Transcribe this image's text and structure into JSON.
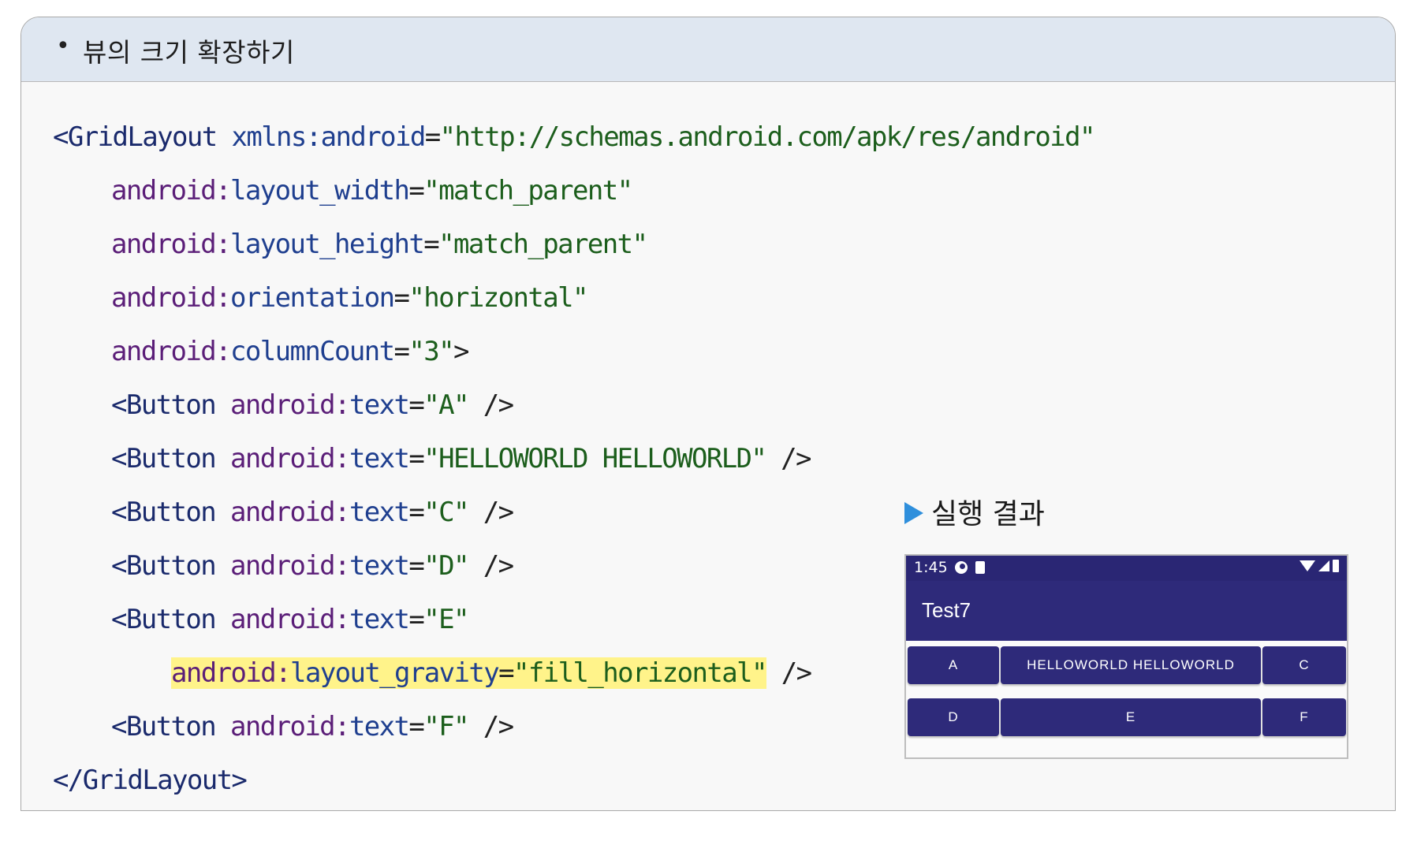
{
  "header": {
    "bullet": "•",
    "title": "뷰의 크기 확장하기"
  },
  "code": {
    "l1_open": "<GridLayout",
    "l1_attr": "xmlns:android",
    "l1_eq": "=",
    "l1_val": "\"http://schemas.android.com/apk/res/android\"",
    "l2_ns": "android:",
    "l2_attr": "layout_width",
    "l2_eq": "=",
    "l2_val": "\"match_parent\"",
    "l3_ns": "android:",
    "l3_attr": "layout_height",
    "l3_eq": "=",
    "l3_val": "\"match_parent\"",
    "l4_ns": "android:",
    "l4_attr": "orientation",
    "l4_eq": "=",
    "l4_val": "\"horizontal\"",
    "l5_ns": "android:",
    "l5_attr": "columnCount",
    "l5_eq": "=",
    "l5_val": "\"3\"",
    "l5_close": ">",
    "btn_tag": "<Button",
    "btn_ns": "android:",
    "btn_attr": "text",
    "btn_eq": "=",
    "btn_end": " />",
    "l6_val": "\"A\"",
    "l7_val": "\"HELLOWORLD HELLOWORLD\"",
    "l8_val": "\"C\"",
    "l9_val": "\"D\"",
    "l10_val": "\"E\"",
    "l11_ns": "android:",
    "l11_attr": "layout_gravity",
    "l11_eq": "=",
    "l11_val": "\"fill_horizontal\"",
    "l11_end": " />",
    "l12_val": "\"F\"",
    "l13_close": "</GridLayout>"
  },
  "result": {
    "label": "실행 결과",
    "status_time": "1:45",
    "app_title": "Test7",
    "row1": [
      "A",
      "HELLOWORLD HELLOWORLD",
      "C"
    ],
    "row2": [
      "D",
      "E",
      "F"
    ],
    "colors": {
      "app_bar": "#2e2a7a",
      "status_bar": "#2a2674",
      "highlight": "#fff38a",
      "header_bg": "#dfe7f1"
    }
  }
}
